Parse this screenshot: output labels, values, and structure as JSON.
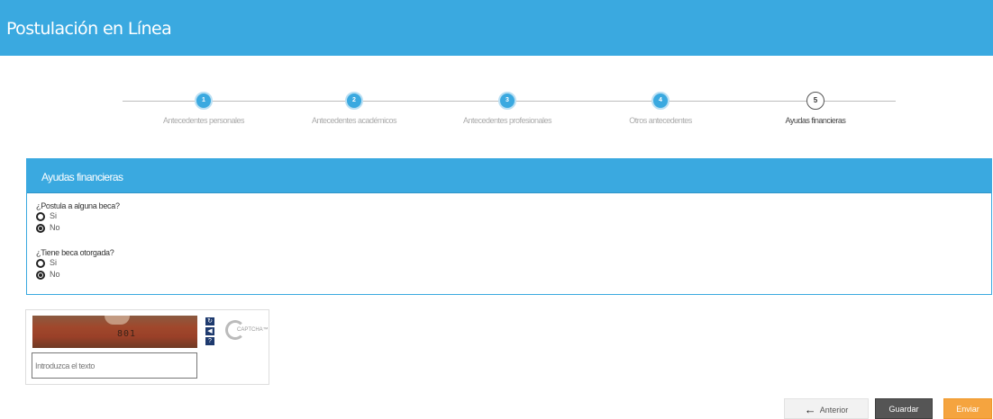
{
  "app": {
    "title": "Postulación en Línea"
  },
  "steps": [
    {
      "number": "1",
      "label": "Antecedentes personales",
      "active": false
    },
    {
      "number": "2",
      "label": "Antecedentes académicos",
      "active": false
    },
    {
      "number": "3",
      "label": "Antecedentes profesionales",
      "active": false
    },
    {
      "number": "4",
      "label": "Otros antecedentes",
      "active": false
    },
    {
      "number": "5",
      "label": "Ayudas financieras",
      "active": true
    }
  ],
  "panel": {
    "title": "Ayudas financieras",
    "questions": [
      {
        "text": "¿Postula a alguna beca?",
        "options": [
          "Si",
          "No"
        ],
        "selected": "No"
      },
      {
        "text": "¿Tiene beca otorgada?",
        "options": [
          "Si",
          "No"
        ],
        "selected": "No"
      }
    ]
  },
  "captcha": {
    "image_text": "801",
    "input_placeholder": "Introduzca el texto",
    "brand": "CAPTCHA™",
    "controls": [
      "refresh-icon",
      "audio-icon",
      "help-icon"
    ]
  },
  "buttons": {
    "previous": "Anterior",
    "save": "Guardar",
    "submit": "Enviar"
  },
  "colors": {
    "accent": "#3aa9e0",
    "save_button": "#555555",
    "submit_button": "#f5a43f"
  }
}
